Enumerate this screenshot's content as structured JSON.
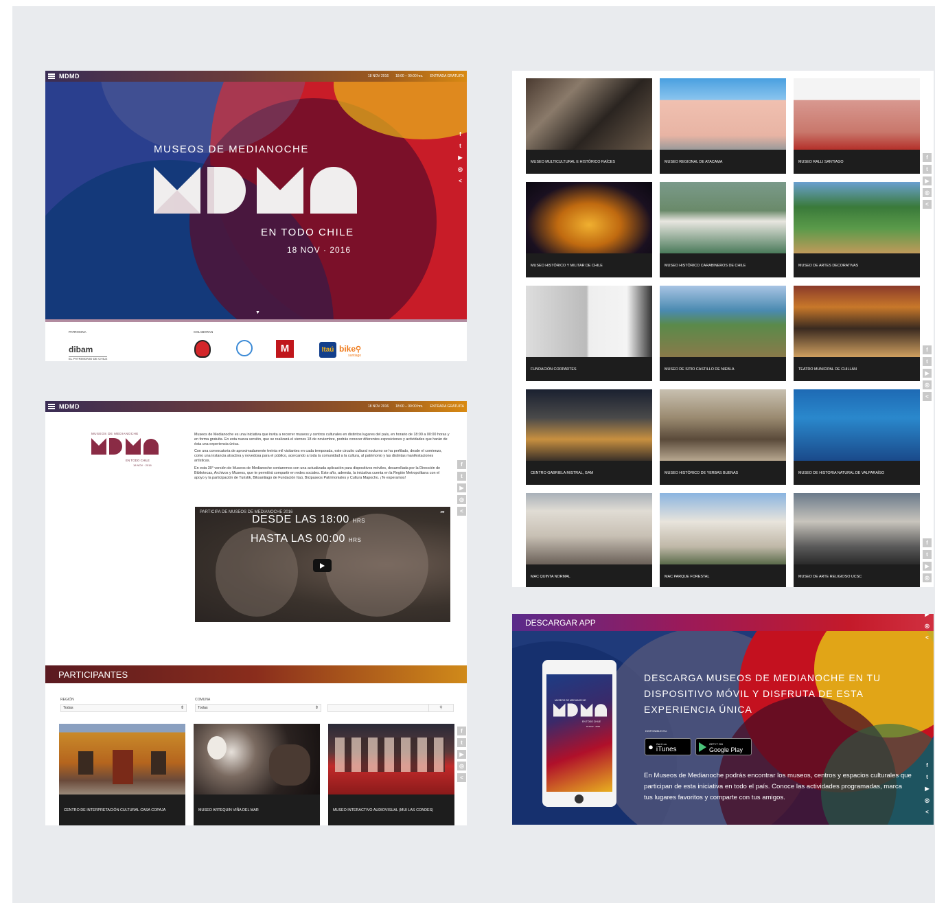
{
  "top_bar": {
    "logo": "MDMD",
    "date": "18 NOV 2016",
    "hours": "18:00 – 00:00 hrs.",
    "entry": "ENTRADA GRATUITA"
  },
  "hero": {
    "kicker": "MUSEOS DE MEDIANOCHE",
    "logo": "MDMD",
    "subtitle": "EN TODO CHILE",
    "date": "18 NOV · 2016",
    "arrow": "▼"
  },
  "sponsors": {
    "patrocina_label": "PATROCINA",
    "colaboran_label": "COLABORAN",
    "dibam": "dibam",
    "dibam_tag": "EL PATRIMONIO DE CHILE",
    "itau": "Itaú",
    "bike": "bike",
    "bike_sub": "santiago"
  },
  "social_icons": [
    "f",
    "t",
    "▶",
    "◎",
    "<"
  ],
  "about": {
    "small_kicker": "MUSEOS DE MEDIANOCHE",
    "small_logo": "MDMD",
    "small_sub": "EN TODO CHILE",
    "small_date": "18 NOV · 2016",
    "para1": "Museos de Medianoche es una iniciativa que invita a recorrer museos y centros culturales en distintos lugares del país, en horario de 18:00 a 00:00 horas y en forma gratuita. En esta nueva versión, que se realizará el viernes 18 de noviembre, podrás conocer diferentes exposiciones y actividades que harán de ésta una experiencia única.",
    "para2": "Con una convocatoria de aproximadamente treinta mil visitantes en cada temporada, este circuito cultural nocturno se ha perfilado, desde el comienzo, como una instancia atractiva y novedosa para el público, acercando a toda la comunidad a la cultura, al patrimonio y las distintas manifestaciones artísticas.",
    "para3": "En esta 30° versión de Museos de Medianoche contaremos con una actualizada aplicación para dispositivos móviles, desarrollada por la Dirección de Bibliotecas, Archivos y Museos, que te permitirá compartir en redes sociales. Este año, además, la iniciativa cuenta en la Región Metropolitana con el apoyo y la participación de Turistik, Biksantiago de Fundación Itaú, Bicipaseos Patrimoniales y Cultura Mapocho. ¡Te esperamos!"
  },
  "video": {
    "title": "PARTICIPA DE MUSEOS DE MEDIANOCHE 2016",
    "line1": "DESDE LAS 18:00",
    "line1_unit": "HRS",
    "line2": "HASTA LAS 00:00",
    "line2_unit": "HRS"
  },
  "participantes": {
    "title": "PARTICIPANTES",
    "region_label": "REGIÓN",
    "region_value": "Todas",
    "comuna_label": "COMUNA",
    "comuna_value": "Todas",
    "search_placeholder": "",
    "cards": [
      "CENTRO DE INTERPRETACIÓN CULTURAL CASA COPAJA",
      "MUSEO ARTEQUIN VIÑA DEL MAR",
      "MUSEO INTERACTIVO AUDIOVISUAL (MUI LAS CONDES)"
    ]
  },
  "grid": {
    "cards": [
      "MUSEO MULTICULTURAL E HISTÓRICO RAÍCES",
      "MUSEO REGIONAL DE ATACAMA",
      "MUSEO RALLI SANTIAGO",
      "MUSEO HISTÓRICO Y MILITAR DE CHILE",
      "MUSEO HISTÓRICO CARABINEROS DE CHILE",
      "MUSEO DE ARTES DECORATIVAS",
      "FUNDACIÓN CORPARTES",
      "MUSEO DE SITIO CASTILLO DE NIEBLA",
      "TEATRO MUNICIPAL DE CHILLÁN",
      "CENTRO GABRIELA MISTRAL, GAM",
      "MUSEO HISTÓRICO DE YERBAS BUENAS",
      "MUSEO DE HISTORIA NATURAL DE VALPARAÍSO",
      "MAC QUINTA NORMAL",
      "MAC PARQUE FORESTAL",
      "MUSEO DE ARTE RELIGIOSO UCSC"
    ]
  },
  "app": {
    "header": "DESCARGAR APP",
    "headline": "DESCARGA MUSEOS DE MEDIANOCHE EN TU DISPOSITIVO MÓVIL Y DISFRUTA DE ESTA EXPERIENCIA ÚNICA",
    "available": "DISPONIBLE EN:",
    "itunes_small": "Get it on",
    "itunes": "iTunes",
    "gplay_small": "GET IT ON",
    "gplay": "Google Play",
    "body": "En Museos de Medianoche podrás encontrar los museos, centros y espacios culturales que participan de esta iniciativa en todo el país. Conoce las actividades programadas, marca tus lugares favoritos y comparte con tus amigos.",
    "phone_kicker": "MUSEOS DE MEDIANOCHE",
    "phone_logo": "MDMD",
    "phone_sub": "EN TODO CHILE",
    "phone_date": "18 NOV · 2016"
  },
  "colors": {
    "board": "#e9ebee",
    "brand_red": "#d4101e",
    "brand_blue": "#1d3c84",
    "brand_yellow": "#e8c21a",
    "label_bg": "#1d1d1d"
  }
}
